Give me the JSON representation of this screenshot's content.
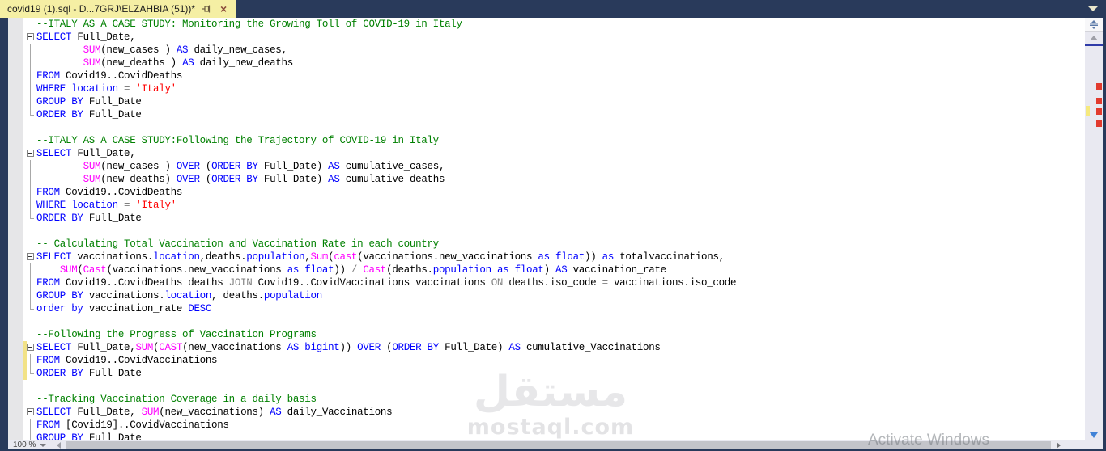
{
  "window": {
    "tab_title": "covid19 (1).sql - D...7GRJ\\ELZAHBIA (51))*"
  },
  "statusbar": {
    "zoom_level": "100 %"
  },
  "watermark": {
    "arabic": "مستقل",
    "latin": "mostaql.com"
  },
  "overlay": {
    "activate_text": "Activate Windows"
  },
  "colors": {
    "frame": "#293A5B",
    "tab_background": "#F5EFA4",
    "editor_background": "#FFFFFF",
    "comment": "#008000",
    "keyword": "#0000FF",
    "builtin_function": "#FF00FF",
    "string": "#FF0000",
    "operator": "#808080",
    "plain_text": "#000000",
    "change_tracking_bar": "#F2E287",
    "scroll_error_mark": "#E23A2E",
    "scroll_change_mark": "#F5E97E"
  },
  "code": {
    "lines": [
      {
        "g": "",
        "cb": false,
        "seg": [
          [
            "c",
            "--ITALY AS A CASE STUDY: Monitoring the Growing Toll of COVID-19 in Italy"
          ]
        ]
      },
      {
        "g": "b",
        "cb": false,
        "seg": [
          [
            "k",
            "SELECT "
          ],
          [
            "t",
            "Full_Date,"
          ]
        ]
      },
      {
        "g": "l",
        "cb": false,
        "seg": [
          [
            "t",
            "        "
          ],
          [
            "f",
            "SUM"
          ],
          [
            "t",
            "(new_cases ) "
          ],
          [
            "k",
            "AS"
          ],
          [
            "t",
            " daily_new_cases,"
          ]
        ]
      },
      {
        "g": "l",
        "cb": false,
        "seg": [
          [
            "t",
            "        "
          ],
          [
            "f",
            "SUM"
          ],
          [
            "t",
            "(new_deaths ) "
          ],
          [
            "k",
            "AS"
          ],
          [
            "t",
            " daily_new_deaths"
          ]
        ]
      },
      {
        "g": "l",
        "cb": false,
        "seg": [
          [
            "k",
            "FROM"
          ],
          [
            "t",
            " Covid19..CovidDeaths"
          ]
        ]
      },
      {
        "g": "l",
        "cb": false,
        "seg": [
          [
            "k",
            "WHERE location"
          ],
          [
            "o",
            " = "
          ],
          [
            "s",
            "'Italy'"
          ]
        ]
      },
      {
        "g": "l",
        "cb": false,
        "seg": [
          [
            "k",
            "GROUP BY"
          ],
          [
            "t",
            " Full_Date"
          ]
        ]
      },
      {
        "g": "e",
        "cb": false,
        "seg": [
          [
            "k",
            "ORDER BY"
          ],
          [
            "t",
            " Full_Date"
          ]
        ]
      },
      {
        "g": "",
        "cb": false,
        "seg": []
      },
      {
        "g": "",
        "cb": false,
        "seg": [
          [
            "c",
            "--ITALY AS A CASE STUDY:Following the Trajectory of COVID-19 in Italy"
          ]
        ]
      },
      {
        "g": "b",
        "cb": false,
        "seg": [
          [
            "k",
            "SELECT "
          ],
          [
            "t",
            "Full_Date,"
          ]
        ]
      },
      {
        "g": "l",
        "cb": false,
        "seg": [
          [
            "t",
            "        "
          ],
          [
            "f",
            "SUM"
          ],
          [
            "t",
            "(new_cases ) "
          ],
          [
            "k",
            "OVER"
          ],
          [
            "t",
            " ("
          ],
          [
            "k",
            "ORDER BY"
          ],
          [
            "t",
            " Full_Date) "
          ],
          [
            "k",
            "AS"
          ],
          [
            "t",
            " cumulative_cases,"
          ]
        ]
      },
      {
        "g": "l",
        "cb": false,
        "seg": [
          [
            "t",
            "        "
          ],
          [
            "f",
            "SUM"
          ],
          [
            "t",
            "(new_deaths) "
          ],
          [
            "k",
            "OVER"
          ],
          [
            "t",
            " ("
          ],
          [
            "k",
            "ORDER BY"
          ],
          [
            "t",
            " Full_Date) "
          ],
          [
            "k",
            "AS"
          ],
          [
            "t",
            " cumulative_deaths"
          ]
        ]
      },
      {
        "g": "l",
        "cb": false,
        "seg": [
          [
            "k",
            "FROM"
          ],
          [
            "t",
            " Covid19..CovidDeaths"
          ]
        ]
      },
      {
        "g": "l",
        "cb": false,
        "seg": [
          [
            "k",
            "WHERE location"
          ],
          [
            "o",
            " = "
          ],
          [
            "s",
            "'Italy'"
          ]
        ]
      },
      {
        "g": "e",
        "cb": false,
        "seg": [
          [
            "k",
            "ORDER BY"
          ],
          [
            "t",
            " Full_Date"
          ]
        ]
      },
      {
        "g": "",
        "cb": false,
        "seg": []
      },
      {
        "g": "",
        "cb": false,
        "seg": [
          [
            "c",
            "-- Calculating Total Vaccination and Vaccination Rate in each country"
          ]
        ]
      },
      {
        "g": "b",
        "cb": false,
        "seg": [
          [
            "k",
            "SELECT "
          ],
          [
            "t",
            "vaccinations."
          ],
          [
            "k",
            "location"
          ],
          [
            "t",
            ",deaths."
          ],
          [
            "k",
            "population"
          ],
          [
            "t",
            ","
          ],
          [
            "f",
            "Sum"
          ],
          [
            "t",
            "("
          ],
          [
            "f",
            "cast"
          ],
          [
            "t",
            "(vaccinations.new_vaccinations "
          ],
          [
            "k",
            "as float"
          ],
          [
            "t",
            ")) "
          ],
          [
            "k",
            "as"
          ],
          [
            "t",
            " totalvaccinations,"
          ]
        ]
      },
      {
        "g": "l",
        "cb": false,
        "seg": [
          [
            "t",
            "    "
          ],
          [
            "f",
            "SUM"
          ],
          [
            "t",
            "("
          ],
          [
            "f",
            "Cast"
          ],
          [
            "t",
            "(vaccinations.new_vaccinations "
          ],
          [
            "k",
            "as float"
          ],
          [
            "t",
            ")) "
          ],
          [
            "o",
            "/"
          ],
          [
            "t",
            " "
          ],
          [
            "f",
            "Cast"
          ],
          [
            "t",
            "(deaths."
          ],
          [
            "k",
            "population"
          ],
          [
            "t",
            " "
          ],
          [
            "k",
            "as float"
          ],
          [
            "t",
            ") "
          ],
          [
            "k",
            "AS"
          ],
          [
            "t",
            " vaccination_rate"
          ]
        ]
      },
      {
        "g": "l",
        "cb": false,
        "seg": [
          [
            "k",
            "FROM"
          ],
          [
            "t",
            " Covid19..CovidDeaths deaths "
          ],
          [
            "o",
            "JOIN"
          ],
          [
            "t",
            " Covid19..CovidVaccinations vaccinations "
          ],
          [
            "o",
            "ON"
          ],
          [
            "t",
            " deaths.iso_code "
          ],
          [
            "o",
            "="
          ],
          [
            "t",
            " vaccinations.iso_code"
          ]
        ]
      },
      {
        "g": "l",
        "cb": false,
        "seg": [
          [
            "k",
            "GROUP BY"
          ],
          [
            "t",
            " vaccinations."
          ],
          [
            "k",
            "location"
          ],
          [
            "t",
            ", deaths."
          ],
          [
            "k",
            "population"
          ]
        ]
      },
      {
        "g": "e",
        "cb": false,
        "seg": [
          [
            "k",
            "order by"
          ],
          [
            "t",
            " vaccination_rate "
          ],
          [
            "k",
            "DESC"
          ]
        ]
      },
      {
        "g": "",
        "cb": false,
        "seg": []
      },
      {
        "g": "",
        "cb": false,
        "seg": [
          [
            "c",
            "--Following the Progress of Vaccination Programs"
          ]
        ]
      },
      {
        "g": "b",
        "cb": true,
        "seg": [
          [
            "k",
            "SELECT "
          ],
          [
            "t",
            "Full_Date,"
          ],
          [
            "f",
            "SUM"
          ],
          [
            "t",
            "("
          ],
          [
            "f",
            "CAST"
          ],
          [
            "t",
            "(new_vaccinations "
          ],
          [
            "k",
            "AS bigint"
          ],
          [
            "t",
            ")) "
          ],
          [
            "k",
            "OVER"
          ],
          [
            "t",
            " ("
          ],
          [
            "k",
            "ORDER BY"
          ],
          [
            "t",
            " Full_Date) "
          ],
          [
            "k",
            "AS"
          ],
          [
            "t",
            " cumulative_Vaccinations"
          ]
        ]
      },
      {
        "g": "l",
        "cb": true,
        "seg": [
          [
            "k",
            "FROM"
          ],
          [
            "t",
            " Covid19..CovidVaccinations"
          ]
        ]
      },
      {
        "g": "e",
        "cb": true,
        "seg": [
          [
            "k",
            "ORDER BY"
          ],
          [
            "t",
            " Full_Date"
          ]
        ]
      },
      {
        "g": "",
        "cb": false,
        "seg": []
      },
      {
        "g": "",
        "cb": false,
        "seg": [
          [
            "c",
            "--Tracking Vaccination Coverage in a daily basis"
          ]
        ]
      },
      {
        "g": "b",
        "cb": false,
        "seg": [
          [
            "k",
            "SELECT "
          ],
          [
            "t",
            "Full_Date, "
          ],
          [
            "f",
            "SUM"
          ],
          [
            "t",
            "(new_vaccinations) "
          ],
          [
            "k",
            "AS"
          ],
          [
            "t",
            " daily_Vaccinations"
          ]
        ]
      },
      {
        "g": "l",
        "cb": false,
        "seg": [
          [
            "k",
            "FROM"
          ],
          [
            "t",
            " [Covid19]..CovidVaccinations"
          ]
        ]
      },
      {
        "g": "l",
        "cb": false,
        "seg": [
          [
            "k",
            "GROUP BY"
          ],
          [
            "t",
            " Full_Date"
          ]
        ]
      }
    ]
  }
}
